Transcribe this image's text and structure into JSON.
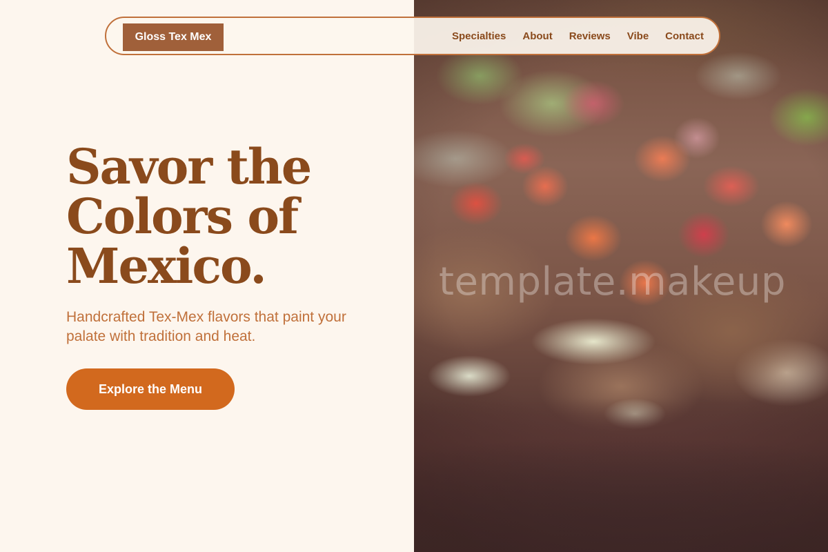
{
  "nav": {
    "brand": "Gloss Tex Mex",
    "links": [
      "Specialties",
      "About",
      "Reviews",
      "Vibe",
      "Contact"
    ]
  },
  "hero": {
    "title_lines": [
      "Savor the",
      "Colors of",
      "Mexico."
    ],
    "subtitle": "Handcrafted Tex-Mex flavors that paint your palate with tradition and heat.",
    "cta_label": "Explore the Menu"
  },
  "watermark": "template.makeup",
  "colors": {
    "background": "#fdf6ee",
    "brand": "#a0603a",
    "heading": "#8a4a1c",
    "accent": "#c0703a",
    "cta": "#d2691e"
  }
}
